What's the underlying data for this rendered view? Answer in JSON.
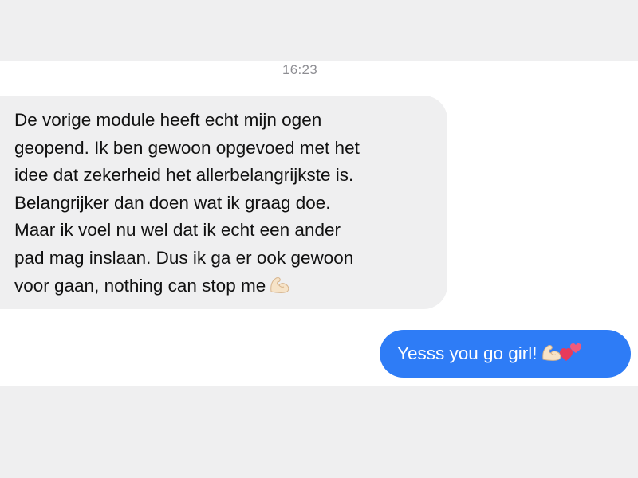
{
  "conversation": {
    "timestamp": "16:23",
    "messages": [
      {
        "direction": "incoming",
        "lines": [
          "De vorige module heeft echt mijn ogen",
          "geopend. Ik ben gewoon opgevoed met het",
          "idee dat zekerheid het allerbelangrijkste is.",
          "Belangrijker dan doen wat ik graag doe.",
          "Maar ik voel nu wel dat ik echt een ander",
          "pad mag inslaan. Dus ik ga er ook gewoon",
          "voor gaan, nothing can stop me"
        ],
        "emoji": [
          "flexed-biceps-icon"
        ]
      },
      {
        "direction": "outgoing",
        "text": "Yesss you go girl!",
        "emoji": [
          "flexed-biceps-icon",
          "two-hearts-icon"
        ]
      }
    ]
  },
  "colors": {
    "background": "#efeff0",
    "panel": "#ffffff",
    "incoming_bubble": "#efeff0",
    "outgoing_bubble": "#2e7cf6",
    "timestamp_text": "#8e8e93"
  }
}
